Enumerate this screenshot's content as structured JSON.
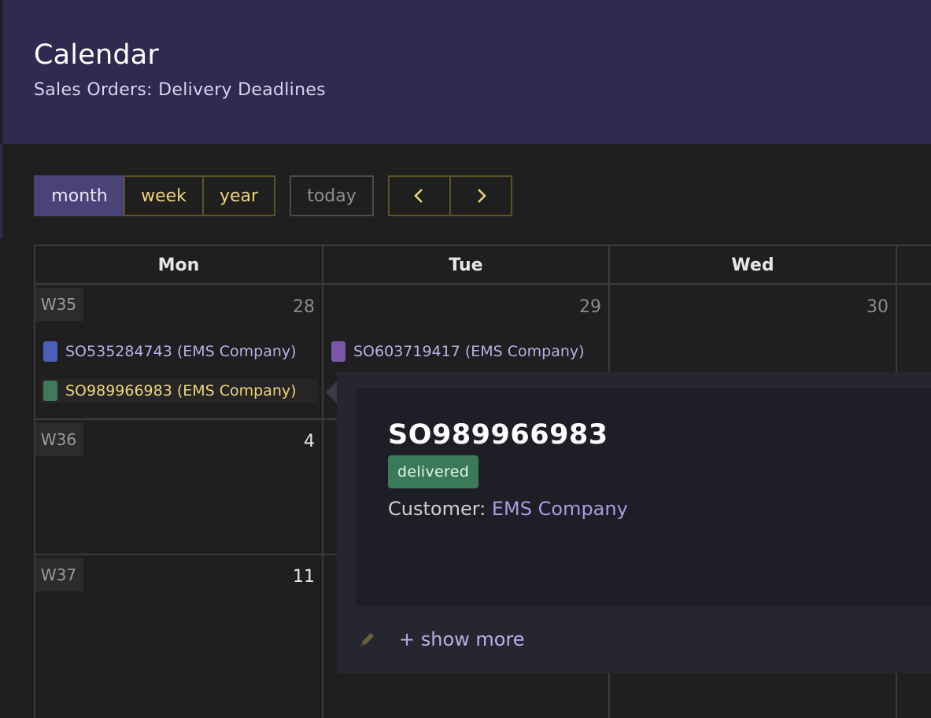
{
  "header": {
    "title": "Calendar",
    "subtitle": "Sales Orders: Delivery Deadlines"
  },
  "toolbar": {
    "views": [
      "month",
      "week",
      "year"
    ],
    "active_view": "month",
    "today_label": "today",
    "prev_icon": "chevron-left-icon",
    "next_icon": "chevron-right-icon"
  },
  "columns": [
    "Mon",
    "Tue",
    "Wed"
  ],
  "weeks": [
    {
      "label": "W35",
      "days": [
        "28",
        "29",
        "30"
      ]
    },
    {
      "label": "W36",
      "days": [
        "4"
      ]
    },
    {
      "label": "W37",
      "days": [
        "11"
      ]
    }
  ],
  "events": [
    {
      "label": "SO535284743 (EMS Company)",
      "color": "#4a5fb8",
      "day": "Mon"
    },
    {
      "label": "SO603719417 (EMS Company)",
      "color": "#7a57a8",
      "day": "Tue"
    },
    {
      "label": "SO989966983 (EMS Company)",
      "color": "#3f7a5a",
      "day": "Mon",
      "selected": true
    }
  ],
  "popover": {
    "title": "SO989966983",
    "status": "delivered",
    "status_color": "#3a7a5a",
    "customer_label": "Customer:",
    "customer_value": "EMS Company",
    "edit_icon": "pencil-icon",
    "show_more": "+ show more"
  }
}
